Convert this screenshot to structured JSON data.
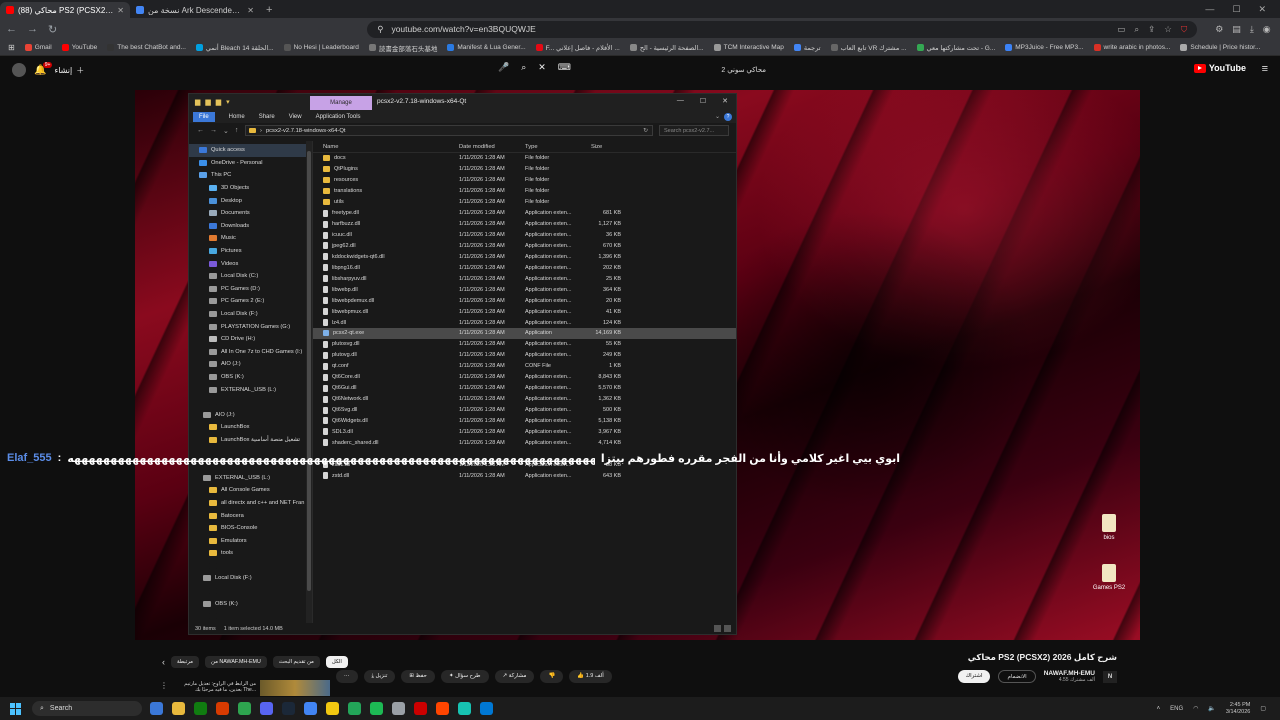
{
  "browser": {
    "tabs": [
      {
        "title": "(88) محاكي PS2 (PCSX2) شرح كا...",
        "active": true,
        "color": "#ff0000"
      },
      {
        "title": "نسخة من Ark Descended Guide مجربة...",
        "active": false,
        "color": "#4285f4"
      }
    ],
    "new_tab": "+",
    "url": "youtube.com/watch?v=en3BQUQWJE",
    "bookmarks": [
      {
        "label": "Gmail",
        "color": "#ea4335"
      },
      {
        "label": "YouTube",
        "color": "#ff0000"
      },
      {
        "label": "The best ChatBot and...",
        "color": "#333333"
      },
      {
        "label": "أنمي Bleach الحلقة 14...",
        "color": "#00a0e0"
      },
      {
        "label": "No Hesi | Leaderboard",
        "color": "#555555"
      },
      {
        "label": "読書金部落石头基地",
        "color": "#777777"
      },
      {
        "label": "Manifest & Lua Gener...",
        "color": "#2a7ae2"
      },
      {
        "label": "F... الأفلام - فاصل إعلاني ...",
        "color": "#e50914"
      },
      {
        "label": "الصفحة الرئيسية - الح...",
        "color": "#888888"
      },
      {
        "label": "TCM Interactive Map",
        "color": "#999999"
      },
      {
        "label": "ترجمة",
        "color": "#4285f4"
      },
      {
        "label": "تابع العاب VR مشترك ...",
        "color": "#666666"
      },
      {
        "label": "تحت مشاركتها معي - G...",
        "color": "#34a853"
      },
      {
        "label": "MP3Juice - Free MP3...",
        "color": "#3b82f6"
      },
      {
        "label": "write arabic in photos...",
        "color": "#d93025"
      },
      {
        "label": "Schedule | Price histor...",
        "color": "#aaaaaa"
      }
    ]
  },
  "youtube_header": {
    "create_label": "إنشاء",
    "notification_count": "9+",
    "search_query": "محاكي سوني 2",
    "logo_text": "YouTube"
  },
  "explorer": {
    "manage_tab": "Manage",
    "window_title": "pcsx2-v2.7.18-windows-x64-Qt",
    "ribbon": [
      "File",
      "Home",
      "Share",
      "View",
      "Application Tools"
    ],
    "address": "pcsx2-v2.7.18-windows-x64-Qt",
    "search_placeholder": "Search pcsx2-v2.7...",
    "columns": {
      "name": "Name",
      "date": "Date modified",
      "type": "Type",
      "size": "Size"
    },
    "sidebar": [
      {
        "label": "Quick access",
        "icon": "star-icon",
        "color": "#3b78d8",
        "indent": 10,
        "selected": true
      },
      {
        "label": "OneDrive - Personal",
        "icon": "cloud-icon",
        "color": "#3b8fe8",
        "indent": 10
      },
      {
        "label": "This PC",
        "icon": "pc-icon",
        "color": "#5aa0e8",
        "indent": 10
      },
      {
        "label": "3D Objects",
        "icon": "cube-icon",
        "color": "#5ab0f0",
        "indent": 20
      },
      {
        "label": "Desktop",
        "icon": "desktop-icon",
        "color": "#4a90d9",
        "indent": 20
      },
      {
        "label": "Documents",
        "icon": "document-icon",
        "color": "#9ab",
        "indent": 20
      },
      {
        "label": "Downloads",
        "icon": "download-icon",
        "color": "#3b78d8",
        "indent": 20
      },
      {
        "label": "Music",
        "icon": "music-icon",
        "color": "#e07a30",
        "indent": 20
      },
      {
        "label": "Pictures",
        "icon": "picture-icon",
        "color": "#48a8e0",
        "indent": 20
      },
      {
        "label": "Videos",
        "icon": "video-icon",
        "color": "#7a5ad9",
        "indent": 20
      },
      {
        "label": "Local Disk (C:)",
        "icon": "drive-icon",
        "color": "#9a9a9a",
        "indent": 20
      },
      {
        "label": "PC Games (D:)",
        "icon": "drive-icon",
        "color": "#9a9a9a",
        "indent": 20
      },
      {
        "label": "PC Games 2 (E:)",
        "icon": "drive-icon",
        "color": "#9a9a9a",
        "indent": 20
      },
      {
        "label": "Local Disk (F:)",
        "icon": "drive-icon",
        "color": "#9a9a9a",
        "indent": 20
      },
      {
        "label": "PLAYSTATION Games (G:)",
        "icon": "drive-icon",
        "color": "#9a9a9a",
        "indent": 20
      },
      {
        "label": "CD Drive (H:)",
        "icon": "disc-icon",
        "color": "#bbbbbb",
        "indent": 20
      },
      {
        "label": "All In One 7z to CHD Games (I:)",
        "icon": "drive-icon",
        "color": "#9a9a9a",
        "indent": 20
      },
      {
        "label": "AIO (J:)",
        "icon": "drive-icon",
        "color": "#9a9a9a",
        "indent": 20
      },
      {
        "label": "OBS (K:)",
        "icon": "drive-icon",
        "color": "#9a9a9a",
        "indent": 20
      },
      {
        "label": "EXTERNAL_USB (L:)",
        "icon": "usb-icon",
        "color": "#9a9a9a",
        "indent": 20
      },
      {
        "label": "",
        "icon": "blank-icon",
        "color": "#191919",
        "indent": 20
      },
      {
        "label": "AIO (J:)",
        "icon": "drive-icon",
        "color": "#9a9a9a",
        "indent": 14
      },
      {
        "label": "LaunchBox",
        "icon": "folder-icon",
        "color": "#e8b93d",
        "indent": 20
      },
      {
        "label": "LaunchBox تشغيل منصة أساسية",
        "icon": "folder-icon",
        "color": "#e8b93d",
        "indent": 20
      },
      {
        "label": "",
        "icon": "blank-icon",
        "color": "#191919",
        "indent": 20
      },
      {
        "label": "",
        "icon": "blank-icon",
        "color": "#191919",
        "indent": 20
      },
      {
        "label": "EXTERNAL_USB (L:)",
        "icon": "usb-icon",
        "color": "#9a9a9a",
        "indent": 14
      },
      {
        "label": "All Console Games",
        "icon": "folder-icon",
        "color": "#e8b93d",
        "indent": 20
      },
      {
        "label": "all directx and c++ and NET Fran",
        "icon": "folder-icon",
        "color": "#e8b93d",
        "indent": 20
      },
      {
        "label": "Batocera",
        "icon": "folder-icon",
        "color": "#e8b93d",
        "indent": 20
      },
      {
        "label": "BIOS-Console",
        "icon": "folder-icon",
        "color": "#e8b93d",
        "indent": 20
      },
      {
        "label": "Emulators",
        "icon": "folder-icon",
        "color": "#e8b93d",
        "indent": 20
      },
      {
        "label": "tools",
        "icon": "folder-icon",
        "color": "#e8b93d",
        "indent": 20
      },
      {
        "label": "",
        "icon": "blank-icon",
        "color": "#191919",
        "indent": 20
      },
      {
        "label": "Local Disk (F:)",
        "icon": "drive-icon",
        "color": "#9a9a9a",
        "indent": 14
      },
      {
        "label": "",
        "icon": "blank-icon",
        "color": "#191919",
        "indent": 20
      },
      {
        "label": "OBS (K:)",
        "icon": "drive-icon",
        "color": "#9a9a9a",
        "indent": 14
      },
      {
        "label": "",
        "icon": "blank-icon",
        "color": "#191919",
        "indent": 20
      },
      {
        "label": "PC Games (D:)",
        "icon": "drive-icon",
        "color": "#9a9a9a",
        "indent": 14
      },
      {
        "label": "",
        "icon": "blank-icon",
        "color": "#191919",
        "indent": 20
      },
      {
        "label": "PC Games 2 (E:)",
        "icon": "drive-icon",
        "color": "#9a9a9a",
        "indent": 14
      }
    ],
    "files": [
      {
        "name": "docs",
        "date": "1/11/2026 1:28 AM",
        "type": "File folder",
        "size": "",
        "kind": "folder"
      },
      {
        "name": "QtPlugins",
        "date": "1/11/2026 1:28 AM",
        "type": "File folder",
        "size": "",
        "kind": "folder"
      },
      {
        "name": "resources",
        "date": "1/11/2026 1:28 AM",
        "type": "File folder",
        "size": "",
        "kind": "folder"
      },
      {
        "name": "translations",
        "date": "1/11/2026 1:28 AM",
        "type": "File folder",
        "size": "",
        "kind": "folder"
      },
      {
        "name": "utils",
        "date": "1/11/2026 1:28 AM",
        "type": "File folder",
        "size": "",
        "kind": "folder"
      },
      {
        "name": "freetype.dll",
        "date": "1/11/2026 1:28 AM",
        "type": "Application exten...",
        "size": "681 KB",
        "kind": "file"
      },
      {
        "name": "harfbuzz.dll",
        "date": "1/11/2026 1:28 AM",
        "type": "Application exten...",
        "size": "1,127 KB",
        "kind": "file"
      },
      {
        "name": "icuuc.dll",
        "date": "1/11/2026 1:28 AM",
        "type": "Application exten...",
        "size": "36 KB",
        "kind": "file"
      },
      {
        "name": "jpeg62.dll",
        "date": "1/11/2026 1:28 AM",
        "type": "Application exten...",
        "size": "670 KB",
        "kind": "file"
      },
      {
        "name": "kddockwidgets-qt6.dll",
        "date": "1/11/2026 1:28 AM",
        "type": "Application exten...",
        "size": "1,396 KB",
        "kind": "file"
      },
      {
        "name": "libpng16.dll",
        "date": "1/11/2026 1:28 AM",
        "type": "Application exten...",
        "size": "202 KB",
        "kind": "file"
      },
      {
        "name": "libsharpyuv.dll",
        "date": "1/11/2026 1:28 AM",
        "type": "Application exten...",
        "size": "25 KB",
        "kind": "file"
      },
      {
        "name": "libwebp.dll",
        "date": "1/11/2026 1:28 AM",
        "type": "Application exten...",
        "size": "364 KB",
        "kind": "file"
      },
      {
        "name": "libwebpdemux.dll",
        "date": "1/11/2026 1:28 AM",
        "type": "Application exten...",
        "size": "20 KB",
        "kind": "file"
      },
      {
        "name": "libwebpmux.dll",
        "date": "1/11/2026 1:28 AM",
        "type": "Application exten...",
        "size": "41 KB",
        "kind": "file"
      },
      {
        "name": "lz4.dll",
        "date": "1/11/2026 1:28 AM",
        "type": "Application exten...",
        "size": "124 KB",
        "kind": "file"
      },
      {
        "name": "pcsx2-qt.exe",
        "date": "1/11/2026 1:28 AM",
        "type": "Application",
        "size": "14,169 KB",
        "kind": "exe",
        "selected": true
      },
      {
        "name": "plutosvg.dll",
        "date": "1/11/2026 1:28 AM",
        "type": "Application exten...",
        "size": "55 KB",
        "kind": "file"
      },
      {
        "name": "plutovg.dll",
        "date": "1/11/2026 1:28 AM",
        "type": "Application exten...",
        "size": "249 KB",
        "kind": "file"
      },
      {
        "name": "qt.conf",
        "date": "1/11/2026 1:28 AM",
        "type": "CONF File",
        "size": "1 KB",
        "kind": "file"
      },
      {
        "name": "Qt6Core.dll",
        "date": "1/11/2026 1:28 AM",
        "type": "Application exten...",
        "size": "8,843 KB",
        "kind": "file"
      },
      {
        "name": "Qt6Gui.dll",
        "date": "1/11/2026 1:28 AM",
        "type": "Application exten...",
        "size": "5,570 KB",
        "kind": "file"
      },
      {
        "name": "Qt6Network.dll",
        "date": "1/11/2026 1:28 AM",
        "type": "Application exten...",
        "size": "1,362 KB",
        "kind": "file"
      },
      {
        "name": "Qt6Svg.dll",
        "date": "1/11/2026 1:28 AM",
        "type": "Application exten...",
        "size": "500 KB",
        "kind": "file"
      },
      {
        "name": "Qt6Widgets.dll",
        "date": "1/11/2026 1:28 AM",
        "type": "Application exten...",
        "size": "5,138 KB",
        "kind": "file"
      },
      {
        "name": "SDL3.dll",
        "date": "1/11/2026 1:28 AM",
        "type": "Application exten...",
        "size": "3,967 KB",
        "kind": "file"
      },
      {
        "name": "shaderc_shared.dll",
        "date": "1/11/2026 1:28 AM",
        "type": "Application exten...",
        "size": "4,714 KB",
        "kind": "file"
      },
      {
        "name": "",
        "date": "",
        "type": "",
        "size": "",
        "kind": "hidden"
      },
      {
        "name": "zlib1.dll",
        "date": "1/11/2026 1:28 AM",
        "type": "Application exten...",
        "size": "88 KB",
        "kind": "file"
      },
      {
        "name": "zstd.dll",
        "date": "1/11/2026 1:28 AM",
        "type": "Application exten...",
        "size": "643 KB",
        "kind": "file"
      }
    ],
    "status_items": "30 items",
    "status_selected": "1 item selected  14.0 MB"
  },
  "chat": {
    "user": "Elaf_555",
    "tail": "ههههههههههههههههههههههههههههههههههههههههههههههههههههههههههههههههههههههههههههههههههههههههههههههههههههههههههههههههه",
    "message": "ابوي بيي اغير كلامي وأنا من الفجر مقرره فطورهم بيتزا"
  },
  "desktop_icons": [
    "bios",
    "Games PS2"
  ],
  "player": {
    "title": "محاكي PS2 (PCSX2) شرح كامل 2026",
    "channel_name": "NAWAF.MH-EMU",
    "channel_avatar": "N",
    "subscribers": "4.55 ألف مشترك",
    "join_label": "الانضمام",
    "subscribe_label": "اشتراك",
    "actions": [
      "1.9 ألف",
      "",
      "مشاركة",
      "طرح سؤال",
      "حفظ",
      "تنزيل",
      "..."
    ],
    "chips": [
      "الكل",
      "من تقديم البحث",
      "من NAWAF.MH-EMU",
      "مرتبطة"
    ],
    "rec_text": "من الرابط في الراوح: تعديل مارتيم بعدين، ما فيه مرحبًا بك The..."
  },
  "taskbar": {
    "search_placeholder": "Search",
    "apps": [
      "#3b78d8",
      "#e8b93d",
      "#107c10",
      "#d83b01",
      "#2ea44f",
      "#5865f2",
      "#1b2838",
      "#4285f4",
      "#f2c811",
      "#23a559",
      "#1db954",
      "#9aa0a6",
      "#cc0000",
      "#ff4500",
      "#17c3b2",
      "#0078d4"
    ],
    "time": "2:45 PM",
    "date": "3/14/2026",
    "lang": "ENG"
  }
}
